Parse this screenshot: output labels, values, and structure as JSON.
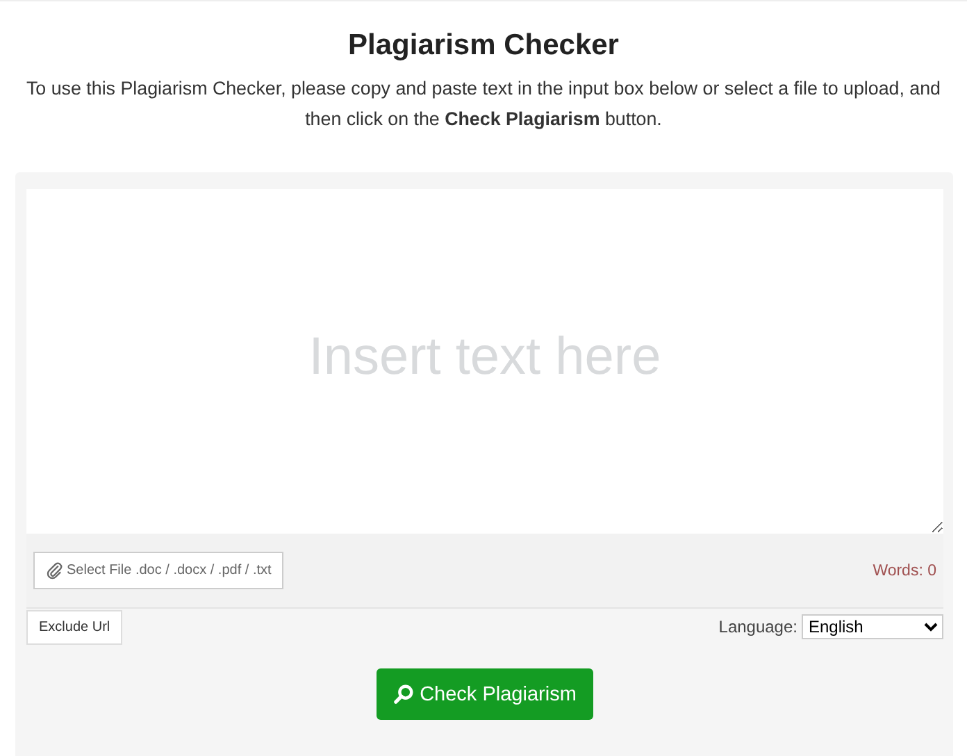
{
  "title": "Plagiarism Checker",
  "intro": "To use this Plagiarism Checker, please copy and paste text in the input box below or select a file to upload, and then click on the **Check Plagiarism** button.",
  "editor": {
    "placeholder": "Insert text here"
  },
  "file_button": "Select File .doc / .docx / .pdf / .txt",
  "word_count": "Words: 0",
  "exclude_button": "Exclude Url",
  "language": {
    "label": "Language:",
    "value": "English"
  },
  "submit_button": "Check Plagiarism"
}
